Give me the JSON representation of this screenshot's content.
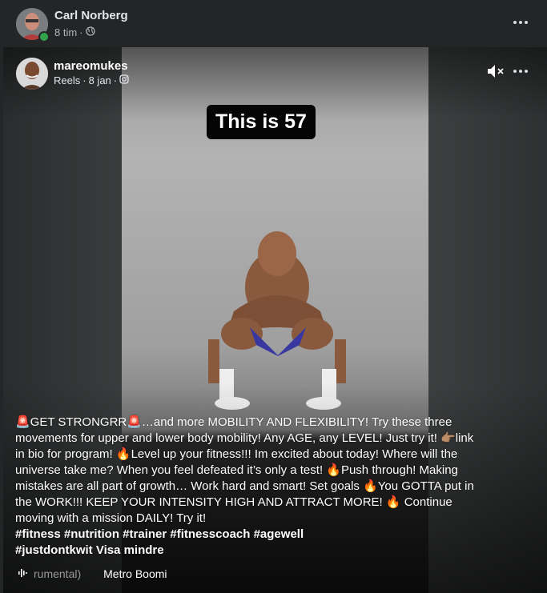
{
  "outer_post": {
    "author": "Carl Norberg",
    "time": "8 tim",
    "separator": "·",
    "audience_icon": "globe-icon"
  },
  "reel": {
    "author": "mareomukes",
    "type": "Reels",
    "date": "8 jan",
    "separator": "·",
    "source_icon": "instagram-icon",
    "caption_overlay": "This is 57",
    "description_lines": [
      "🚨GET STRONGRR🚨…and more MOBILITY AND FLEXIBILITY! Try these three",
      "movements for upper and lower body mobility! Any AGE, any LEVEL! Just try it! 👉🏽link",
      "in bio for program! 🔥Level up your fitness!!! Im excited about today! Where will the",
      "universe take me? When you feel defeated it’s only a test! 🔥Push through! Making",
      "mistakes are all part of growth… Work hard and smart! Set goals 🔥You GOTTA put in",
      "the WORK!!! KEEP YOUR INTENSITY HIGH AND ATTRACT MORE! 🔥 Continue",
      "moving with a mission DAILY! Try it!"
    ],
    "hashtags_line1": "#fitness #nutrition #trainer #fitnesscoach #agewell",
    "hashtags_line2": "#justdontkwit Visa mindre",
    "music_track": "rumental)",
    "music_artist": "Metro Boomi"
  },
  "colors": {
    "background": "#242526",
    "text_primary": "#e4e6eb",
    "text_secondary": "#b0b3b8",
    "online": "#31a24c"
  }
}
